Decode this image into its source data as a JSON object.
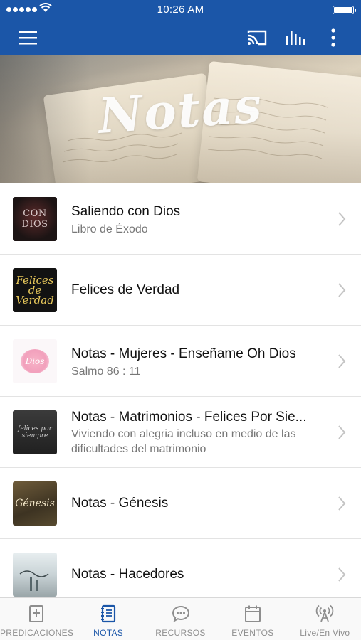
{
  "status_bar": {
    "time": "10:26 AM"
  },
  "nav_bar": {
    "icons": [
      "menu-icon",
      "cast-icon",
      "levels-icon",
      "more-vertical-icon"
    ]
  },
  "hero": {
    "title": "Notas"
  },
  "notes": [
    {
      "title": "Saliendo con Dios",
      "subtitle": "Libro de Éxodo",
      "thumb_text": "CON DIOS"
    },
    {
      "title": "Felices de Verdad",
      "subtitle": "",
      "thumb_text": "Felices de Verdad"
    },
    {
      "title": "Notas - Mujeres - Enseñame Oh Dios",
      "subtitle": "Salmo 86 : 11",
      "thumb_text": "Dios"
    },
    {
      "title": "Notas - Matrimonios - Felices Por Sie...",
      "subtitle": "Viviendo con alegria incluso en medio de las dificultades del matrimonio",
      "thumb_text": "felices por siempre"
    },
    {
      "title": "Notas - Génesis",
      "subtitle": "",
      "thumb_text": "Génesis"
    },
    {
      "title": "Notas - Hacedores",
      "subtitle": "",
      "thumb_text": ""
    }
  ],
  "tab_bar": {
    "tabs": [
      {
        "label": "PREDICACIONES",
        "icon": "bible-plus-icon",
        "active": false
      },
      {
        "label": "NOTAS",
        "icon": "notebook-icon",
        "active": true
      },
      {
        "label": "RECURSOS",
        "icon": "chat-bubble-icon",
        "active": false
      },
      {
        "label": "EVENTOS",
        "icon": "calendar-icon",
        "active": false
      },
      {
        "label": "Live/En Vivo",
        "icon": "broadcast-icon",
        "active": false
      }
    ]
  },
  "colors": {
    "brand": "#1b56a8",
    "tab_inactive": "#8e8e8e",
    "divider": "#e3e3e3"
  }
}
